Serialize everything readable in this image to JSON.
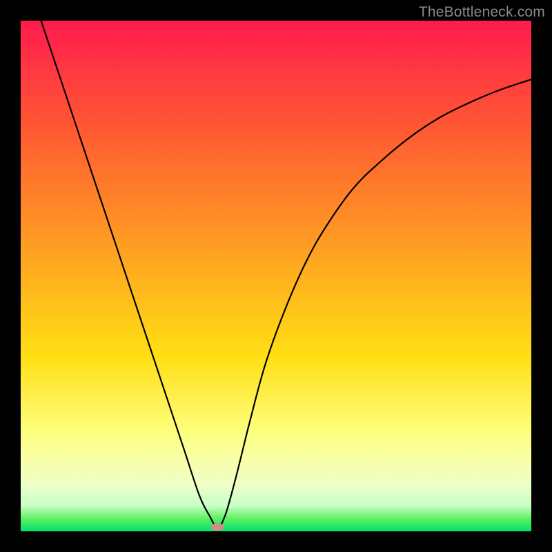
{
  "watermark": "TheBottleneck.com",
  "chart_data": {
    "type": "line",
    "title": "",
    "xlabel": "",
    "ylabel": "",
    "xlim": [
      0,
      100
    ],
    "ylim": [
      0,
      100
    ],
    "grid": false,
    "series": [
      {
        "name": "curve",
        "x": [
          4,
          8,
          12,
          16,
          20,
          24,
          28,
          32,
          35,
          37,
          38.5,
          40,
          42,
          45,
          48,
          52,
          56,
          60,
          65,
          70,
          76,
          82,
          88,
          94,
          100
        ],
        "y": [
          100,
          88,
          76,
          64,
          52,
          40,
          28,
          16,
          7,
          3,
          0.8,
          3,
          10,
          22,
          33,
          44,
          53,
          60,
          67,
          72,
          77,
          81,
          84,
          86.5,
          88.5
        ]
      }
    ],
    "marker": {
      "x": 38.5,
      "y": 0.8
    },
    "background_gradient": {
      "top": "#ff1a4d",
      "mid": "#ffe014",
      "bottom": "#00e070"
    }
  }
}
